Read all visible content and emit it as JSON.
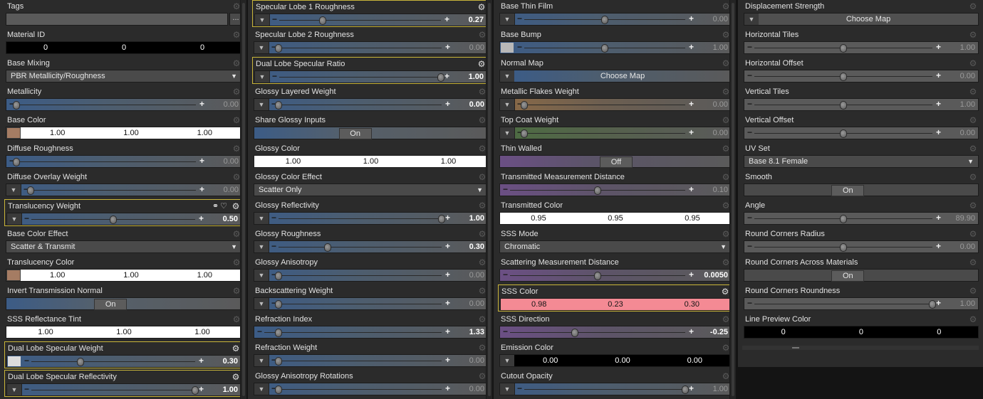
{
  "columns": [
    {
      "id": "col1",
      "props": [
        {
          "label": "Tags",
          "type": "tags",
          "button": "..."
        },
        {
          "label": "Material ID",
          "type": "triple",
          "style": "black",
          "values": [
            "0",
            "0",
            "0"
          ]
        },
        {
          "label": "Base Mixing",
          "type": "dropdown",
          "value": "PBR Metallicity/Roughness"
        },
        {
          "label": "Metallicity",
          "type": "slider",
          "color": "blue",
          "value": "0.00",
          "pos": 0.0
        },
        {
          "label": "Base Color",
          "type": "triple",
          "style": "white",
          "swatch": "#a57c63",
          "values": [
            "1.00",
            "1.00",
            "1.00"
          ]
        },
        {
          "label": "Diffuse Roughness",
          "type": "slider",
          "color": "blue",
          "value": "0.00",
          "pos": 0.0
        },
        {
          "label": "Diffuse Overlay Weight",
          "type": "slider",
          "color": "blue",
          "value": "0.00",
          "pos": 0.0,
          "triangle": true
        },
        {
          "label": "Translucency Weight",
          "type": "slider",
          "color": "blue",
          "value": "0.50",
          "pos": 0.5,
          "triangle": true,
          "highlight": true,
          "bright": true,
          "extraIcons": true
        },
        {
          "label": "Base Color Effect",
          "type": "dropdown",
          "value": "Scatter & Transmit"
        },
        {
          "label": "Translucency Color",
          "type": "triple",
          "style": "white",
          "swatch": "#a57c63",
          "values": [
            "1.00",
            "1.00",
            "1.00"
          ]
        },
        {
          "label": "Invert Transmission Normal",
          "type": "toggle",
          "value": "On",
          "pos": 0.44
        },
        {
          "label": "SSS Reflectance Tint",
          "type": "triple",
          "style": "white",
          "values": [
            "1.00",
            "1.00",
            "1.00"
          ]
        },
        {
          "label": "Dual Lobe Specular Weight",
          "type": "slider",
          "color": "blue",
          "value": "0.30",
          "pos": 0.3,
          "swatch": "#dcdcdc",
          "highlight": true,
          "bright": true
        },
        {
          "label": "Dual Lobe Specular Reflectivity",
          "type": "slider",
          "color": "blue",
          "value": "1.00",
          "pos": 1.0,
          "triangle": true,
          "highlight": true,
          "bright": true
        }
      ]
    },
    {
      "id": "col2",
      "props": [
        {
          "label": "Specular Lobe 1 Roughness",
          "type": "slider",
          "color": "blue",
          "value": "0.27",
          "pos": 0.27,
          "triangle": true,
          "highlight": true,
          "bright": true
        },
        {
          "label": "Specular Lobe 2 Roughness",
          "type": "slider",
          "color": "blue",
          "value": "0.00",
          "pos": 0.0,
          "triangle": true
        },
        {
          "label": "Dual Lobe Specular Ratio",
          "type": "slider",
          "color": "blue",
          "value": "1.00",
          "pos": 1.0,
          "triangle": true,
          "highlight": true,
          "bright": true
        },
        {
          "label": "Glossy Layered Weight",
          "type": "slider",
          "color": "blue",
          "value": "0.00",
          "pos": 0.0,
          "triangle": true,
          "bright": true
        },
        {
          "label": "Share Glossy Inputs",
          "type": "toggle",
          "value": "On",
          "pos": 0.43
        },
        {
          "label": "Glossy Color",
          "type": "triple",
          "style": "white",
          "values": [
            "1.00",
            "1.00",
            "1.00"
          ]
        },
        {
          "label": "Glossy Color Effect",
          "type": "dropdown",
          "value": "Scatter Only"
        },
        {
          "label": "Glossy Reflectivity",
          "type": "slider",
          "color": "blue",
          "value": "1.00",
          "pos": 1.0,
          "triangle": true,
          "bright": true
        },
        {
          "label": "Glossy Roughness",
          "type": "slider",
          "color": "blue",
          "value": "0.30",
          "pos": 0.3,
          "triangle": true,
          "bright": true
        },
        {
          "label": "Glossy Anisotropy",
          "type": "slider",
          "color": "blue",
          "value": "0.00",
          "pos": 0.0,
          "triangle": true
        },
        {
          "label": "Backscattering Weight",
          "type": "slider",
          "color": "blue",
          "value": "0.00",
          "pos": 0.0,
          "triangle": true
        },
        {
          "label": "Refraction Index",
          "type": "slider",
          "color": "blue",
          "value": "1.33",
          "pos": 0.08,
          "bright": true
        },
        {
          "label": "Refraction Weight",
          "type": "slider",
          "color": "blue",
          "value": "0.00",
          "pos": 0.0,
          "triangle": true
        },
        {
          "label": "Glossy Anisotropy Rotations",
          "type": "slider",
          "color": "blue",
          "value": "0.00",
          "pos": 0.0,
          "triangle": true
        }
      ]
    },
    {
      "id": "col3",
      "props": [
        {
          "label": "Base Thin Film",
          "type": "slider",
          "color": "blue",
          "value": "0.00",
          "pos": 0.5,
          "triangle": true
        },
        {
          "label": "Base Bump",
          "type": "slider",
          "color": "blue",
          "value": "1.00",
          "pos": 0.5,
          "swatch": "#b8b8b8"
        },
        {
          "label": "Normal Map",
          "type": "map",
          "value": "Choose Map"
        },
        {
          "label": "Metallic Flakes Weight",
          "type": "slider",
          "color": "orange",
          "value": "0.00",
          "pos": 0.0,
          "triangle": true
        },
        {
          "label": "Top Coat Weight",
          "type": "slider",
          "color": "green",
          "value": "0.00",
          "pos": 0.0,
          "triangle": true
        },
        {
          "label": "Thin Walled",
          "type": "toggle",
          "color": "purple",
          "value": "Off",
          "pos": 0.5
        },
        {
          "label": "Transmitted Measurement Distance",
          "type": "slider",
          "color": "purple",
          "value": "0.10",
          "pos": 0.5
        },
        {
          "label": "Transmitted Color",
          "type": "triple",
          "style": "white",
          "values": [
            "0.95",
            "0.95",
            "0.95"
          ]
        },
        {
          "label": "SSS Mode",
          "type": "dropdown",
          "value": "Chromatic"
        },
        {
          "label": "Scattering Measurement Distance",
          "type": "slider",
          "color": "purple",
          "value": "0.0050",
          "pos": 0.5,
          "bright": true
        },
        {
          "label": "SSS Color",
          "type": "triple",
          "style": "pink",
          "values": [
            "0.98",
            "0.23",
            "0.30"
          ],
          "highlight": true
        },
        {
          "label": "SSS Direction",
          "type": "slider",
          "color": "purple",
          "value": "-0.25",
          "pos": 0.37,
          "bright": true
        },
        {
          "label": "Emission Color",
          "type": "triple",
          "style": "black",
          "values": [
            "0.00",
            "0.00",
            "0.00"
          ],
          "triangle": true
        },
        {
          "label": "Cutout Opacity",
          "type": "slider",
          "color": "blue",
          "value": "1.00",
          "pos": 1.0,
          "triangle": true
        }
      ]
    },
    {
      "id": "col4",
      "props": [
        {
          "label": "Displacement Strength",
          "type": "map",
          "value": "Choose Map",
          "flat": true
        },
        {
          "label": "Horizontal Tiles",
          "type": "slider",
          "color": "grey",
          "value": "1.00",
          "pos": 0.5
        },
        {
          "label": "Horizontal Offset",
          "type": "slider",
          "color": "grey",
          "value": "0.00",
          "pos": 0.5
        },
        {
          "label": "Vertical Tiles",
          "type": "slider",
          "color": "grey",
          "value": "1.00",
          "pos": 0.5
        },
        {
          "label": "Vertical Offset",
          "type": "slider",
          "color": "grey",
          "value": "0.00",
          "pos": 0.5
        },
        {
          "label": "UV Set",
          "type": "dropdown",
          "value": "Base 8.1 Female"
        },
        {
          "label": "Smooth",
          "type": "toggle",
          "color": "grey",
          "value": "On",
          "pos": 0.44
        },
        {
          "label": "Angle",
          "type": "slider",
          "color": "grey",
          "value": "89.90",
          "pos": 0.5
        },
        {
          "label": "Round Corners Radius",
          "type": "slider",
          "color": "grey",
          "value": "0.00",
          "pos": 0.5
        },
        {
          "label": "Round Corners Across Materials",
          "type": "toggle",
          "color": "grey",
          "value": "On",
          "pos": 0.44
        },
        {
          "label": "Round Corners Roundness",
          "type": "slider",
          "color": "grey",
          "value": "1.00",
          "pos": 1.0
        },
        {
          "label": "Line Preview Color",
          "type": "triple",
          "style": "black",
          "values": [
            "0",
            "0",
            "0"
          ]
        }
      ]
    }
  ],
  "icons": {
    "minus": "−",
    "plus": "+",
    "gear": "⚙",
    "triangle": "▼",
    "link_heart": "⚭♡"
  }
}
